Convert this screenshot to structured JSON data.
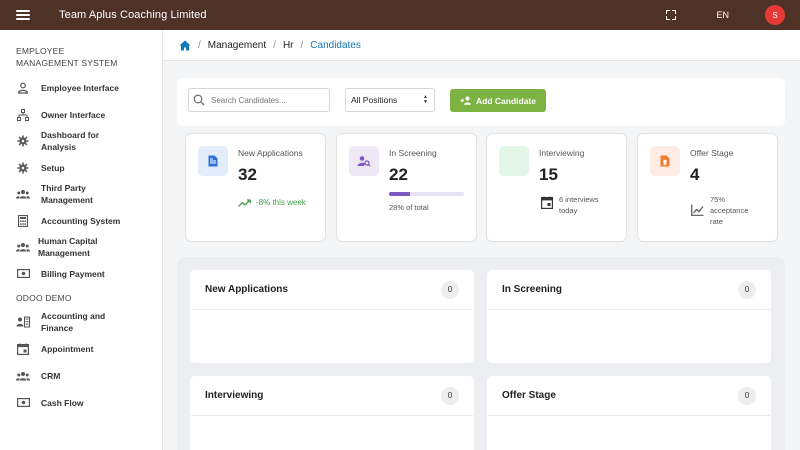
{
  "header": {
    "app_title": "Team Aplus Coaching Limited",
    "language": "EN",
    "avatar_initial": "S"
  },
  "sidebar": {
    "section1_title": "EMPLOYEE MANAGEMENT SYSTEM",
    "section1_items": [
      {
        "label": "Employee Interface",
        "icon": "person-icon"
      },
      {
        "label": "Owner Interface",
        "icon": "org-chart-icon"
      },
      {
        "label": "Dashboard for Analysis",
        "icon": "gear-icon"
      },
      {
        "label": "Setup",
        "icon": "gear-icon"
      },
      {
        "label": "Third Party Management",
        "icon": "people-group-icon"
      },
      {
        "label": "Accounting System",
        "icon": "calculator-icon"
      },
      {
        "label": "Human Capital Management",
        "icon": "people-group-icon"
      },
      {
        "label": "Billing Payment",
        "icon": "money-icon"
      }
    ],
    "section2_title": "ODOO DEMO",
    "section2_items": [
      {
        "label": "Accounting and Finance",
        "icon": "accounting-icon"
      },
      {
        "label": "Appointment",
        "icon": "calendar-icon"
      },
      {
        "label": "CRM",
        "icon": "people-group-icon"
      },
      {
        "label": "Cash Flow",
        "icon": "money-icon"
      }
    ]
  },
  "breadcrumb": {
    "items": [
      "Management",
      "Hr"
    ],
    "active": "Candidates",
    "separator": "/"
  },
  "toolbar": {
    "search_placeholder": "Search Candidates...",
    "position_filter": "All Positions",
    "add_button": "Add Candidate"
  },
  "stats": {
    "new_applications": {
      "label": "New Applications",
      "value": "32",
      "trend": "-8% this week"
    },
    "in_screening": {
      "label": "In Screening",
      "value": "22",
      "progress_percent": 28,
      "progress_text": "28% of total"
    },
    "interviewing": {
      "label": "Interviewing",
      "value": "15",
      "note": "6 interviews today"
    },
    "offer_stage": {
      "label": "Offer Stage",
      "value": "4",
      "note": "75% acceptance rate"
    }
  },
  "board": {
    "columns": [
      {
        "title": "New Applications",
        "count": "0"
      },
      {
        "title": "In Screening",
        "count": "0"
      },
      {
        "title": "Interviewing",
        "count": "0"
      },
      {
        "title": "Offer Stage",
        "count": "0"
      }
    ]
  },
  "colors": {
    "topbar": "#4e3228",
    "accent_blue": "#1479b8",
    "add_button": "#7cb342",
    "avatar": "#e53935",
    "progress": "#7e57c2",
    "trend_green": "#43a047"
  }
}
